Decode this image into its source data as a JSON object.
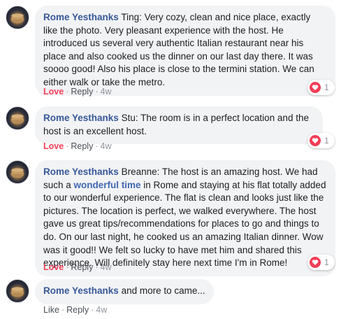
{
  "colors": {
    "author": "#385898",
    "link_highlight": "#4267b2",
    "love": "#f33e58",
    "meta": "#90949c",
    "bubble_bg": "#f2f3f5"
  },
  "comments": [
    {
      "author": "Rome Yesthanks",
      "text": " Ting: Very cozy, clean and nice place, exactly like the photo. Very pleasant experience with the host. He introduced us several very authentic Italian restaurant near his place and also cooked us the dinner on our last day there. It was soooo good! Also his place is close to the termini station. We can either walk or take the metro.",
      "reaction_label": "Love",
      "reply_label": "Reply",
      "time": "4w",
      "reaction_icon": "heart-icon",
      "reaction_count": "1"
    },
    {
      "author": "Rome Yesthanks",
      "text": " Stu: The room is in a perfect location and the host is an excellent host.",
      "reaction_label": "Love",
      "reply_label": "Reply",
      "time": "4w",
      "reaction_icon": "heart-icon",
      "reaction_count": "1"
    },
    {
      "author": "Rome Yesthanks",
      "text_before": " Breanne: The host is an amazing host. We had such a ",
      "highlight": "wonderful time",
      "text_after": " in Rome and staying at his flat totally added to our wonderful experience. The flat is clean and looks just like the pictures. The location is perfect, we walked everywhere. The host gave us great tips/recommendations for places to go and things to do. On our last night, he cooked us an amazing Italian dinner. Wow was it good!! We felt so lucky to have met him and shared this experience. Will definitely stay here next time I'm in Rome!",
      "reaction_label": "Love",
      "reply_label": "Reply",
      "time": "4w",
      "reaction_icon": "heart-icon",
      "reaction_count": "1"
    },
    {
      "author": "Rome Yesthanks",
      "text": " and more to came...",
      "reaction_label": "Like",
      "reply_label": "Reply",
      "time": "4w"
    }
  ],
  "separator": "·"
}
